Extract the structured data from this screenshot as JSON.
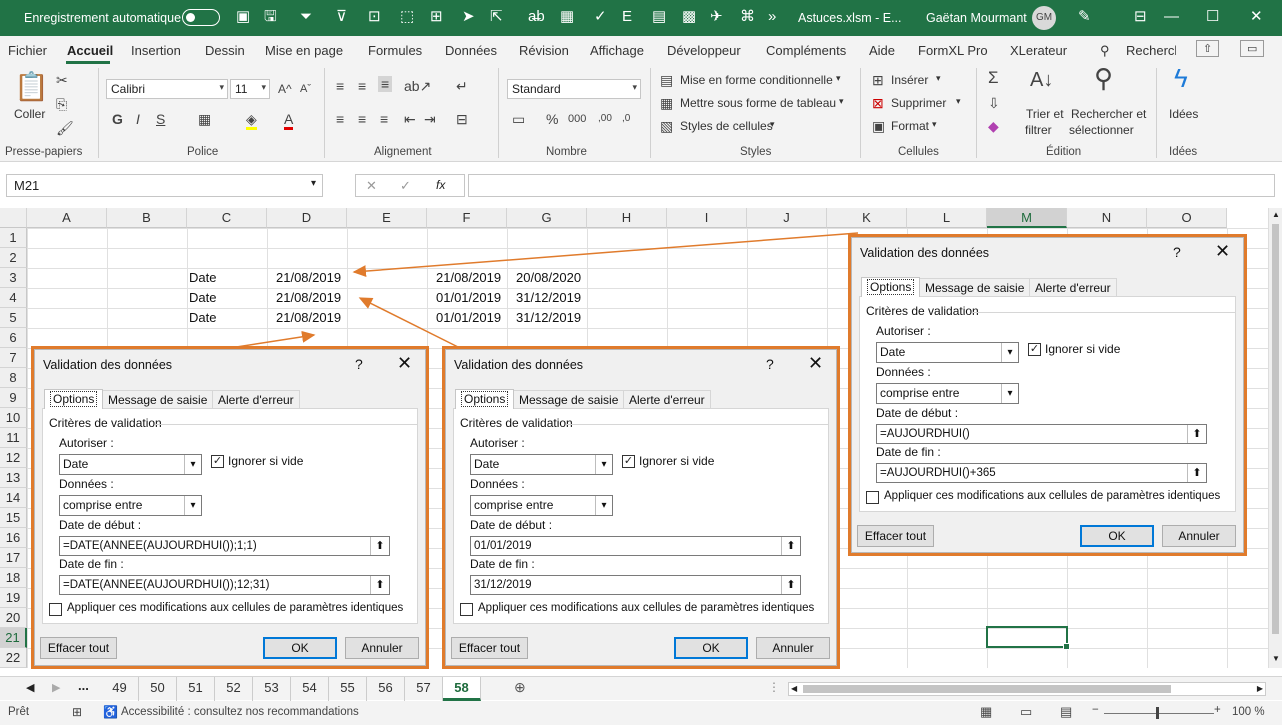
{
  "titlebar": {
    "autosave": "Enregistrement automatique",
    "filename": "Astuces.xlsm  -  E...",
    "user": "Gaëtan Mourmant",
    "initials": "GM"
  },
  "tabs": [
    "Fichier",
    "Accueil",
    "Insertion",
    "Dessin",
    "Mise en page",
    "Formules",
    "Données",
    "Révision",
    "Affichage",
    "Développeur",
    "Compléments",
    "Aide",
    "FormXL Pro",
    "XLerateur"
  ],
  "search": "Recherchercl",
  "ribbon": {
    "paste": "Coller",
    "font": "Calibri",
    "size": "11",
    "number_format": "Standard",
    "cond_format": "Mise en forme conditionnelle",
    "format_table": "Mettre sous forme de tableau",
    "cell_styles": "Styles de cellules",
    "insert": "Insérer",
    "delete": "Supprimer",
    "format": "Format",
    "sort_l1": "Trier et",
    "sort_l2": "filtrer",
    "find_l1": "Rechercher et",
    "find_l2": "sélectionner",
    "ideas": "Idées",
    "groups": [
      "Presse-papiers",
      "Police",
      "Alignement",
      "Nombre",
      "Styles",
      "Cellules",
      "Édition",
      "Idées"
    ]
  },
  "namebox": "M21",
  "columns": [
    "A",
    "B",
    "C",
    "D",
    "E",
    "F",
    "G",
    "H",
    "I",
    "J",
    "K",
    "L",
    "M",
    "N",
    "O"
  ],
  "rows": [
    "1",
    "2",
    "3",
    "4",
    "5",
    "6",
    "7",
    "8",
    "9",
    "10",
    "11",
    "12",
    "13",
    "14",
    "15",
    "16",
    "17",
    "18",
    "19",
    "20",
    "21",
    "22"
  ],
  "cells": {
    "c3": "Date",
    "d3": "21/08/2019",
    "f3": "21/08/2019",
    "g3": "20/08/2020",
    "c4": "Date",
    "d4": "21/08/2019",
    "f4": "01/01/2019",
    "g4": "31/12/2019",
    "c5": "Date",
    "d5": "21/08/2019",
    "f5": "01/01/2019",
    "g5": "31/12/2019"
  },
  "sheets": {
    "nav_dots": "...",
    "tabs": [
      "49",
      "50",
      "51",
      "52",
      "53",
      "54",
      "55",
      "56",
      "57",
      "58"
    ],
    "active": "58"
  },
  "status": {
    "ready": "Prêt",
    "accessibility": "Accessibilité : consultez nos recommandations",
    "zoom": "100 %"
  },
  "dialog_common": {
    "title": "Validation des données",
    "help": "?",
    "close": "✕",
    "tab_options": "Options",
    "tab_input": "Message de saisie",
    "tab_error": "Alerte d'erreur",
    "criteria": "Critères de validation",
    "allow_label": "Autoriser :",
    "allow_value": "Date",
    "ignore_blank": "Ignorer si vide",
    "data_label": "Données :",
    "data_value": "comprise entre",
    "start_label": "Date de début :",
    "end_label": "Date de fin :",
    "apply_all": "Appliquer ces modifications aux cellules de paramètres identiques",
    "clear_all": "Effacer tout",
    "ok": "OK",
    "cancel": "Annuler"
  },
  "dialogs": [
    {
      "start": "=AUJOURDHUI()",
      "end": "=AUJOURDHUI()+365"
    },
    {
      "start": "=DATE(ANNEE(AUJOURDHUI());1;1)",
      "end": "=DATE(ANNEE(AUJOURDHUI());12;31)"
    },
    {
      "start": "01/01/2019",
      "end": "31/12/2019"
    }
  ],
  "colors": {
    "excel_green": "#217346",
    "highlight_orange": "#e07b2c"
  }
}
